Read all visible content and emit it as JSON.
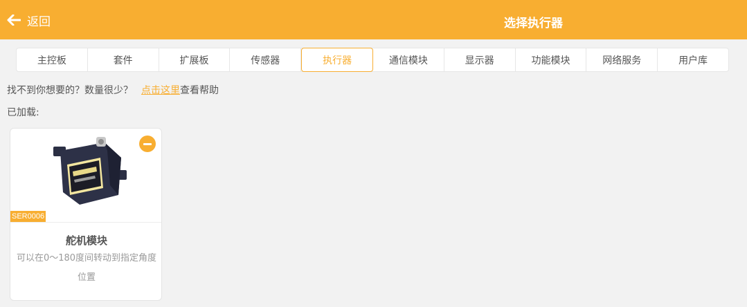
{
  "header": {
    "back_label": "返回",
    "title": "选择执行器",
    "background": "#f8ae31"
  },
  "tabs": [
    {
      "label": "主控板"
    },
    {
      "label": "套件"
    },
    {
      "label": "扩展板"
    },
    {
      "label": "传感器"
    },
    {
      "label": "执行器",
      "active": true
    },
    {
      "label": "通信模块"
    },
    {
      "label": "显示器"
    },
    {
      "label": "功能模块"
    },
    {
      "label": "网络服务"
    },
    {
      "label": "用户库"
    }
  ],
  "help": {
    "prefix": "找不到你想要的？数量很少？",
    "link": "点击这里",
    "suffix": "查看帮助"
  },
  "loaded_label": "已加载:",
  "module": {
    "sku": "SER0006",
    "name": "舵机模块",
    "description": "可以在0～180度间转动到指定角度位置",
    "image_icon": "servo-motor-image",
    "remove_icon": "minus-circle-icon"
  },
  "accent_color": "#f8ae31"
}
